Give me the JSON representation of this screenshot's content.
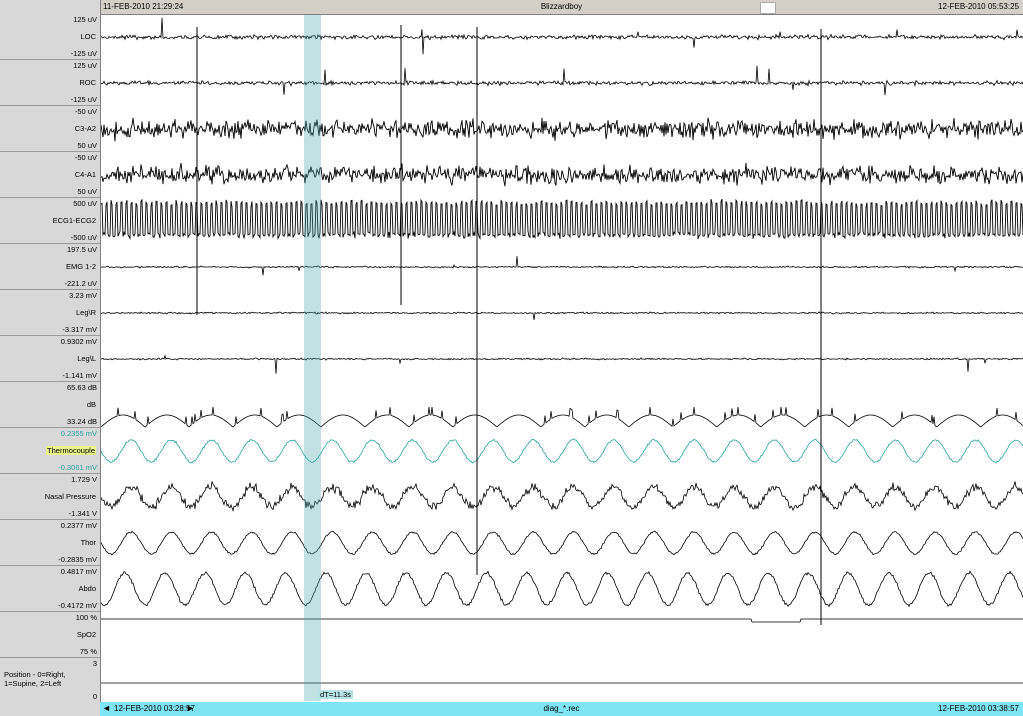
{
  "header": {
    "start_time": "11-FEB-2010 21:29:24",
    "title": "Blizzardboy",
    "end_time": "12-FEB-2010 05:53:25"
  },
  "footer": {
    "left_time": "12-FEB-2010 03:28:57",
    "file": "diag_*.rec",
    "right_time": "12-FEB-2010 03:38:57",
    "left_arrow": "◄",
    "right_arrow": "►"
  },
  "selection": {
    "label": "dT=11.3s"
  },
  "channels": [
    {
      "name": "LOC",
      "max": "125 uV",
      "min": "-125 uV"
    },
    {
      "name": "ROC",
      "max": "125 uV",
      "min": "-125 uV"
    },
    {
      "name": "C3-A2",
      "max": "-50 uV",
      "min": "50 uV"
    },
    {
      "name": "C4-A1",
      "max": "-50 uV",
      "min": "50 uV"
    },
    {
      "name": "ECG1-ECG2",
      "max": "500 uV",
      "min": "-500 uV"
    },
    {
      "name": "EMG 1-2",
      "max": "197.5 uV",
      "min": "-221.2 uV"
    },
    {
      "name": "Leg\\R",
      "max": "3.23 mV",
      "min": "-3.317 mV"
    },
    {
      "name": "Leg\\L",
      "max": "0.9302 mV",
      "min": "-1.141 mV"
    },
    {
      "name": "dB",
      "max": "65.63 dB",
      "min": "33.24 dB"
    },
    {
      "name": "Thermocouple",
      "max": "0.2355 mV",
      "min": "-0.3061 mV"
    },
    {
      "name": "Nasal Pressure",
      "max": "1.729 V",
      "min": "-1.341 V"
    },
    {
      "name": "Thor",
      "max": "0.2377 mV",
      "min": "-0.2835 mV"
    },
    {
      "name": "Abdo",
      "max": "0.4817 mV",
      "min": "-0.4172 mV"
    },
    {
      "name": "SpO2",
      "max": "100 %",
      "min": "75 %"
    },
    {
      "name": "Position - 0=Right, 1=Supine, 2=Left",
      "max": "3",
      "min": "0"
    }
  ],
  "colors": {
    "trace": "#000000",
    "highlight_trace": "#2aa3a3",
    "selection": "#50aaaf",
    "footer_bg": "#7fe4f3",
    "label_highlight": "#e9f58a"
  }
}
